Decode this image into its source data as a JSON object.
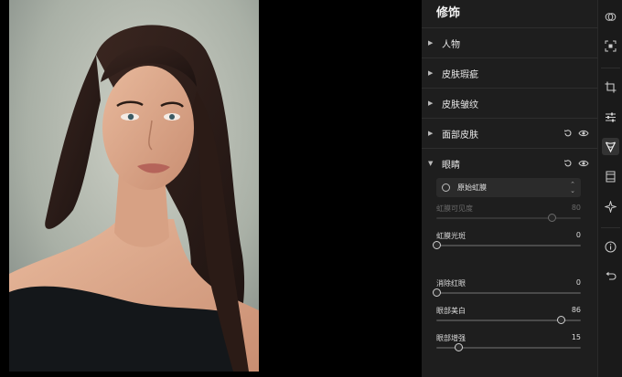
{
  "panel": {
    "title": "修饰",
    "sections": [
      {
        "label": "人物",
        "expanded": false
      },
      {
        "label": "皮肤瑕疵",
        "expanded": false
      },
      {
        "label": "皮肤皱纹",
        "expanded": false
      },
      {
        "label": "面部皮肤",
        "expanded": false
      },
      {
        "label": "眼睛",
        "expanded": true
      }
    ],
    "eyes": {
      "dropdown_value": "原始虹膜",
      "sliders": [
        {
          "label": "虹膜可见度",
          "value": "80",
          "fraction": 0.8,
          "disabled": true
        },
        {
          "label": "虹膜光斑",
          "value": "0",
          "fraction": 0.0,
          "disabled": false
        },
        {
          "label": "消除红眼",
          "value": "0",
          "fraction": 0.0,
          "disabled": false
        },
        {
          "label": "眼部美白",
          "value": "86",
          "fraction": 0.86,
          "disabled": false
        },
        {
          "label": "眼部增强",
          "value": "15",
          "fraction": 0.15,
          "disabled": false
        }
      ]
    }
  },
  "tools": [
    {
      "icon": "layers-icon",
      "active": false
    },
    {
      "icon": "focus-frame-icon",
      "active": false
    },
    {
      "icon": "crop-icon",
      "active": false
    },
    {
      "icon": "adjustments-icon",
      "active": false
    },
    {
      "icon": "face-retouch-icon",
      "active": true
    },
    {
      "icon": "portrait-frame-icon",
      "active": false
    },
    {
      "icon": "sparkle-icon",
      "active": false
    },
    {
      "icon": "info-icon",
      "active": false
    },
    {
      "icon": "undo-icon",
      "active": false
    }
  ],
  "colors": {
    "panel_bg": "#1e1e1e",
    "toolbar_bg": "#1a1a1a",
    "canvas_bg": "#000000",
    "active_tool_bg": "#333333"
  }
}
